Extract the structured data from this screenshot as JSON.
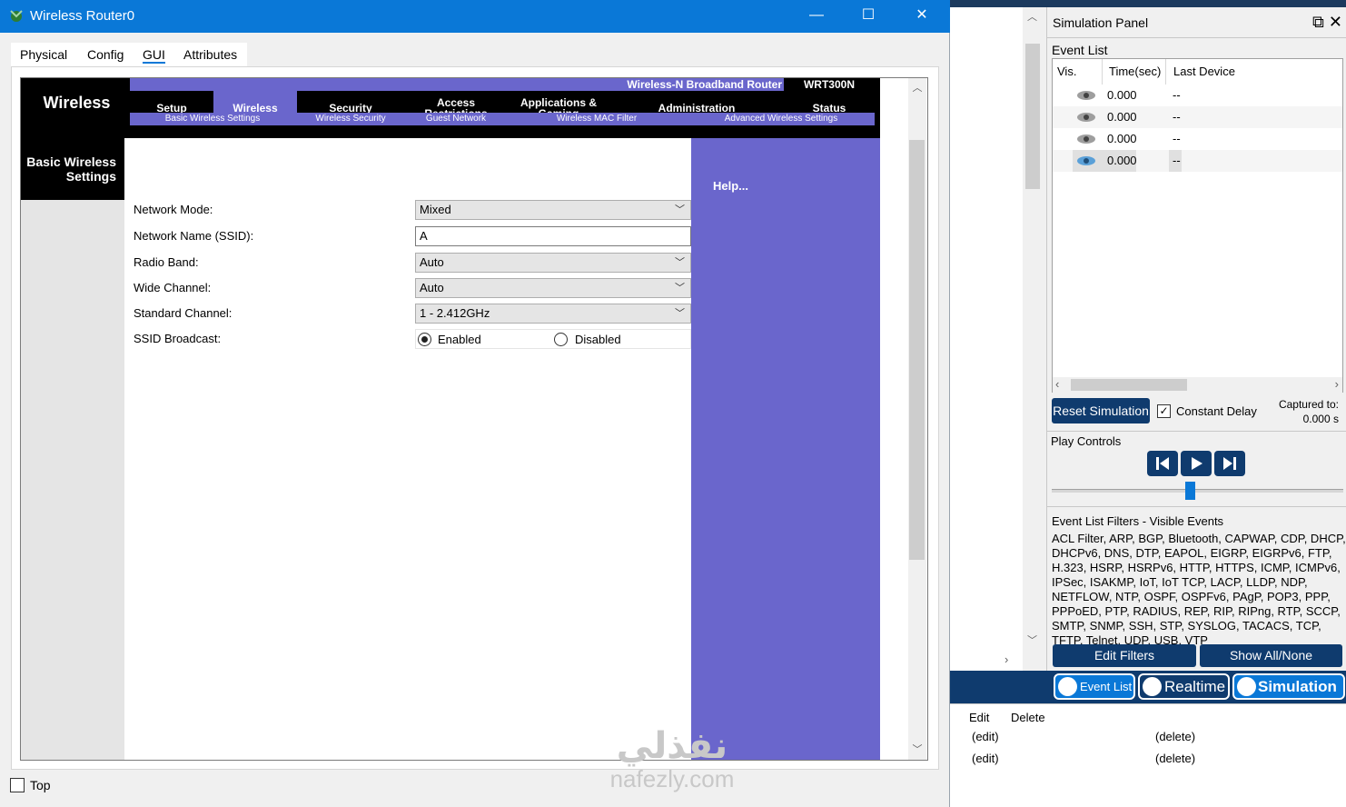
{
  "window": {
    "title": "Wireless Router0",
    "min": "—",
    "max": "☐",
    "close": "✕",
    "tabs": [
      "Physical",
      "Config",
      "GUI",
      "Attributes"
    ],
    "active_tab": "GUI"
  },
  "router": {
    "logo": "Wireless",
    "product": "Wireless-N Broadband Router",
    "model": "WRT300N",
    "menu": [
      "Setup",
      "Wireless",
      "Security",
      "Access Restrictions",
      "Applications & Gaming",
      "Administration",
      "Status"
    ],
    "active_menu": "Wireless",
    "submenu": [
      "Basic Wireless Settings",
      "Wireless Security",
      "Guest Network",
      "Wireless MAC Filter",
      "Advanced Wireless Settings"
    ],
    "section_title": "Basic Wireless Settings",
    "help": "Help...",
    "fields": {
      "network_mode": {
        "label": "Network Mode:",
        "value": "Mixed"
      },
      "ssid": {
        "label": "Network Name (SSID):",
        "value": "A"
      },
      "radio_band": {
        "label": "Radio Band:",
        "value": "Auto"
      },
      "wide_channel": {
        "label": "Wide Channel:",
        "value": "Auto"
      },
      "standard_channel": {
        "label": "Standard Channel:",
        "value": "1 - 2.412GHz"
      },
      "ssid_broadcast": {
        "label": "SSID Broadcast:",
        "enabled": "Enabled",
        "disabled": "Disabled",
        "selected": "Enabled"
      }
    }
  },
  "footer": {
    "top_label": "Top"
  },
  "simulation": {
    "title": "Simulation Panel",
    "event_list_label": "Event List",
    "columns": [
      "Vis.",
      "Time(sec)",
      "Last Device"
    ],
    "events": [
      {
        "time": "0.000",
        "device": "--"
      },
      {
        "time": "0.000",
        "device": "--"
      },
      {
        "time": "0.000",
        "device": "--"
      },
      {
        "time": "0.000",
        "device": "--"
      }
    ],
    "reset": "Reset Simulation",
    "constant_delay": "Constant Delay",
    "captured_label": "Captured to:",
    "captured_value": "0.000 s",
    "play_controls": "Play Controls",
    "filters_title": "Event List Filters - Visible Events",
    "filters_text": "ACL Filter, ARP, BGP, Bluetooth, CAPWAP, CDP, DHCP, DHCPv6, DNS, DTP, EAPOL, EIGRP, EIGRPv6, FTP, H.323, HSRP, HSRPv6, HTTP, HTTPS, ICMP, ICMPv6, IPSec, ISAKMP, IoT, IoT TCP, LACP, LLDP, NDP, NETFLOW, NTP, OSPF, OSPFv6, PAgP, POP3, PPP, PPPoED, PTP, RADIUS, REP, RIP, RIPng, RTP, SCCP, SMTP, SNMP, SSH, STP, SYSLOG, TACACS, TCP, TFTP, Telnet, UDP, USB, VTP",
    "edit_filters": "Edit Filters",
    "show_all": "Show All/None"
  },
  "modes": {
    "event_list": "Event List",
    "realtime": "Realtime",
    "simulation": "Simulation"
  },
  "bottom": {
    "h1": "Edit",
    "h2": "Delete",
    "rows": [
      {
        "edit": "(edit)",
        "delete": "(delete)"
      },
      {
        "edit": "(edit)",
        "delete": "(delete)"
      }
    ]
  },
  "watermark": {
    "arabic": "نفذلي",
    "latin": "nafezly.com"
  }
}
